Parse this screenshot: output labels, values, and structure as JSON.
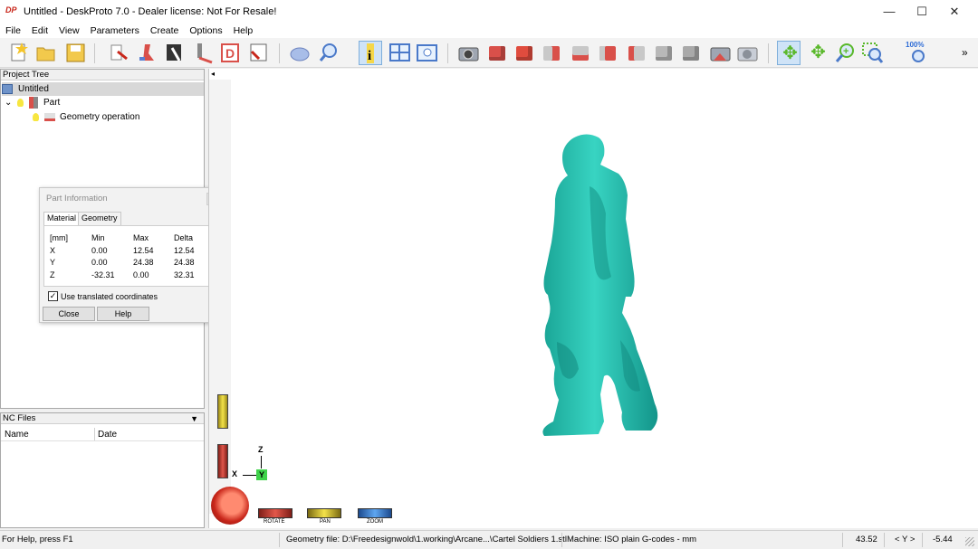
{
  "window": {
    "title": "Untitled - DeskProto 7.0 - Dealer license: Not For Resale!",
    "logo": "DP",
    "minimize": "—",
    "maximize": "☐",
    "close": "✕"
  },
  "menu": [
    "File",
    "Edit",
    "View",
    "Parameters",
    "Create",
    "Options",
    "Help"
  ],
  "toolbar": {
    "zoom_level": "100%",
    "overflow": "»",
    "colors": {
      "selected_bg": "#cfe3f7",
      "cube_red": "#d9504a",
      "cube_grey": "#b8b8b8",
      "move_green": "#59b82a"
    }
  },
  "project_tree": {
    "title": "Project Tree",
    "items": [
      {
        "label": "Untitled"
      },
      {
        "label": "Part",
        "expander": "⌄"
      },
      {
        "label": "Geometry operation"
      }
    ]
  },
  "nc_files": {
    "title": "NC Files",
    "columns": [
      "Name",
      "Date"
    ]
  },
  "part_info": {
    "title": "Part Information",
    "tabs": [
      "Material",
      "Geometry"
    ],
    "headers": [
      "[mm]",
      "Min",
      "Max",
      "Delta"
    ],
    "rows": [
      {
        "axis": "X",
        "min": "0.00",
        "max": "12.54",
        "delta": "12.54"
      },
      {
        "axis": "Y",
        "min": "0.00",
        "max": "24.38",
        "delta": "24.38"
      },
      {
        "axis": "Z",
        "min": "-32.31",
        "max": "0.00",
        "delta": "32.31"
      }
    ],
    "checkbox_label": "Use translated coordinates",
    "checkbox_checked": "✓",
    "close_button": "Close",
    "help_button": "Help",
    "more": "▼"
  },
  "viewport": {
    "collapse": "◂",
    "model_color": "#2cc4b5",
    "axes": {
      "z": "Z",
      "x": "X",
      "y": "Y"
    },
    "controls": [
      "ROTATE",
      "PAN",
      "ZOOM"
    ]
  },
  "statusbar": {
    "help": "For Help, press F1",
    "geometry": "Geometry file: D:\\Freedesignwold\\1.working\\Arcane...\\Cartel Soldiers 1.stl",
    "machine": "Machine: ISO plain G-codes - mm",
    "x_value": "43.52",
    "axis_toggle": "< Y >",
    "y_value": "-5.44"
  }
}
